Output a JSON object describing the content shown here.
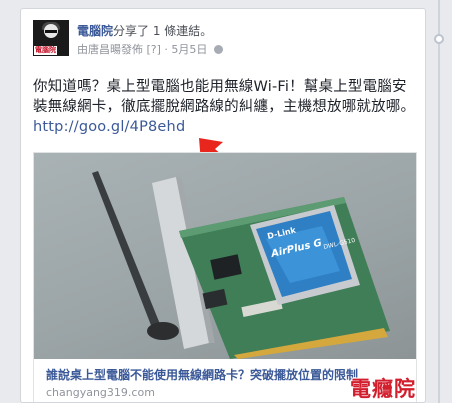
{
  "post": {
    "page_name": "電腦院",
    "action_text": "分享了 1 條連結。",
    "posted_by": "由唐昌暘發佈",
    "help_marker": "[?]",
    "date": "· 5月5日",
    "body_text": "你知道嗎？桌上型電腦也能用無線Wi-Fi！幫桌上型電腦安裝無線網卡，徹底擺脫網路線的糾纏，主機想放哪就放哪。",
    "link_text": "http://goo.gl/4P8ehd"
  },
  "preview": {
    "card_brand": "D-Link",
    "card_product": "AirPlus G",
    "card_model": "DWL-G510",
    "caption": "誰說桌上型電腦不能使用無線網路卡？突破擺放位置的限制",
    "domain": "changyang319.com"
  },
  "avatar": {
    "label": "電腦院"
  },
  "watermark": {
    "text": "電癮院"
  },
  "icons": {
    "globe": "globe-icon",
    "arrow": "red-arrow-icon"
  },
  "colors": {
    "link_blue": "#3b5998",
    "text": "#1d2129",
    "meta": "#90949c",
    "arrow_red": "#e8261e",
    "watermark_red": "#d21f2e"
  }
}
